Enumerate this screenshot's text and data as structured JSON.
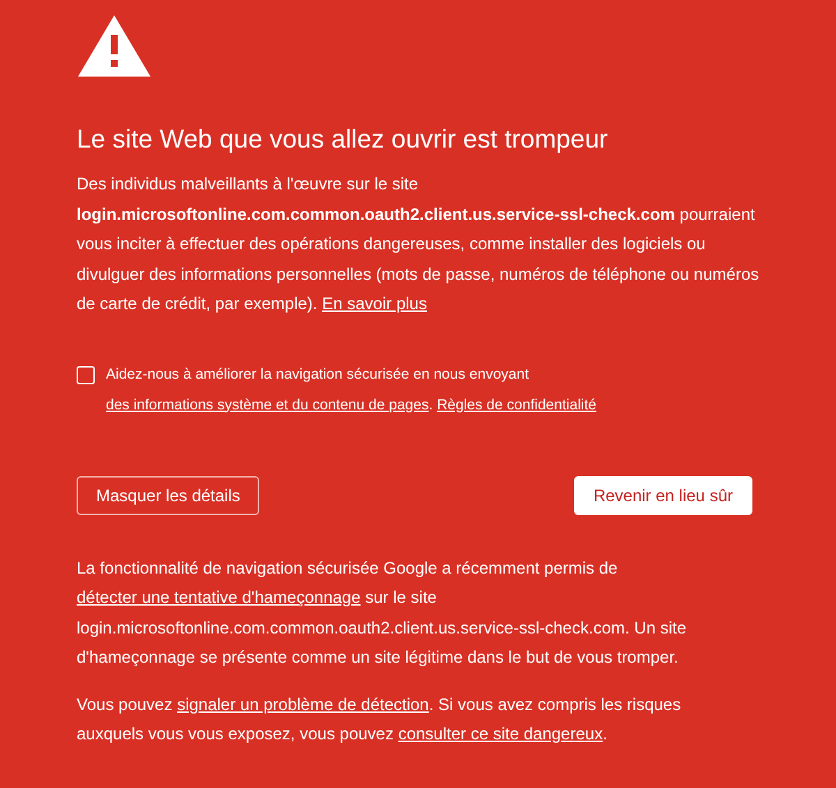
{
  "heading": "Le site Web que vous allez ouvrir est trompeur",
  "intro": [
    {
      "kind": "text",
      "text": "Des individus malveillants à l'œuvre sur le site "
    },
    {
      "kind": "bold",
      "text": "login.microsoftonline.com.common.oauth2.client.us.service-ssl-check.com"
    },
    {
      "kind": "text",
      "text": " pourraient vous inciter à effectuer des opérations dangereuses, comme installer des logiciels ou divulguer des informations personnelles (mots de passe, numéros de téléphone ou numéros de carte de crédit, par exemple). "
    },
    {
      "kind": "link",
      "text": "En savoir plus"
    }
  ],
  "report_opt_in": {
    "checked": false,
    "segments": [
      {
        "kind": "text",
        "text": "Aidez-nous à améliorer la navigation sécurisée en nous envoyant "
      },
      {
        "kind": "link",
        "text": "des informations système et du contenu de pages"
      },
      {
        "kind": "link",
        "lead": ". ",
        "text": "Règles de confidentialité"
      }
    ]
  },
  "buttons": [
    {
      "label": "Masquer les détails",
      "kind": "secondary"
    },
    {
      "label": "Revenir en lieu sûr",
      "kind": "primary"
    }
  ],
  "details": [
    [
      {
        "kind": "text",
        "text": "La fonctionnalité de navigation sécurisée Google a récemment permis de "
      },
      {
        "kind": "link",
        "text": "détecter une tentative d'hameçonnage"
      },
      {
        "kind": "text",
        "text": " sur le site login.microsoftonline.com.common.oauth2.client.us.service-ssl-check.com. Un site d'hameçonnage se présente comme un site légitime dans le but de vous tromper."
      }
    ],
    [
      {
        "kind": "text",
        "text": "Vous pouvez "
      },
      {
        "kind": "link",
        "text": "signaler un problème de détection"
      },
      {
        "kind": "text",
        "text": ". Si vous avez compris les risques auxquels vous vous exposez, vous pouvez "
      },
      {
        "kind": "link",
        "text": "consulter ce site dangereux"
      },
      {
        "kind": "text",
        "text": "."
      }
    ]
  ]
}
